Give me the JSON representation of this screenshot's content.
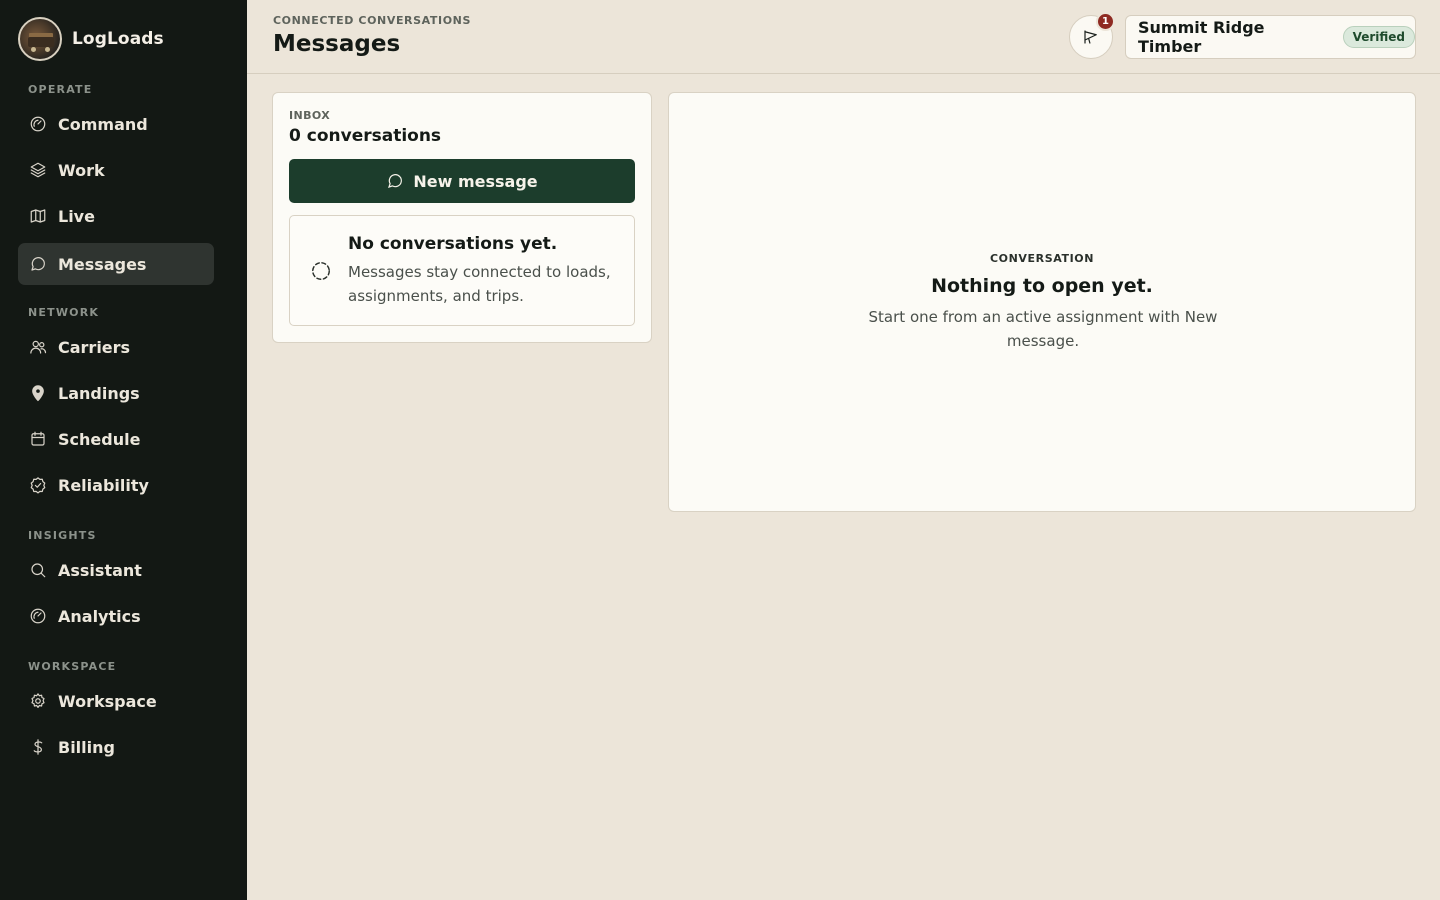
{
  "brand": {
    "name": "LogLoads"
  },
  "sidebar": {
    "sections": [
      {
        "label": "OPERATE"
      },
      {
        "label": "NETWORK"
      },
      {
        "label": "INSIGHTS"
      },
      {
        "label": "WORKSPACE"
      }
    ],
    "items": [
      {
        "label": "Command",
        "icon": "gauge-icon"
      },
      {
        "label": "Work",
        "icon": "layers-icon"
      },
      {
        "label": "Live",
        "icon": "map-icon"
      },
      {
        "label": "Messages",
        "icon": "chat-icon",
        "active": true
      },
      {
        "label": "Carriers",
        "icon": "users-icon"
      },
      {
        "label": "Landings",
        "icon": "map-pin-icon"
      },
      {
        "label": "Schedule",
        "icon": "calendar-icon"
      },
      {
        "label": "Reliability",
        "icon": "badge-check-icon"
      },
      {
        "label": "Assistant",
        "icon": "search-icon"
      },
      {
        "label": "Analytics",
        "icon": "gauge-icon"
      },
      {
        "label": "Workspace",
        "icon": "gear-icon"
      },
      {
        "label": "Billing",
        "icon": "dollar-icon"
      }
    ]
  },
  "header": {
    "eyebrow": "CONNECTED CONVERSATIONS",
    "title": "Messages",
    "notifications": {
      "count": "1",
      "icon": "megaphone-icon"
    },
    "org": {
      "name": "Summit Ridge Timber",
      "status": "Verified"
    }
  },
  "inbox": {
    "label": "INBOX",
    "count": "0 conversations",
    "new_message_label": "New message",
    "empty_title": "No conversations yet.",
    "empty_desc": "Messages stay connected to loads, assignments, and trips."
  },
  "conversation": {
    "label": "CONVERSATION",
    "title": "Nothing to open yet.",
    "desc": "Start one from an active assignment with New message."
  },
  "colors": {
    "sidebar_bg": "#131814",
    "page_bg": "#ece5d9",
    "accent": "#1c3d2c",
    "badge": "#8e2a22",
    "verified_bg": "#dbe9dc"
  }
}
